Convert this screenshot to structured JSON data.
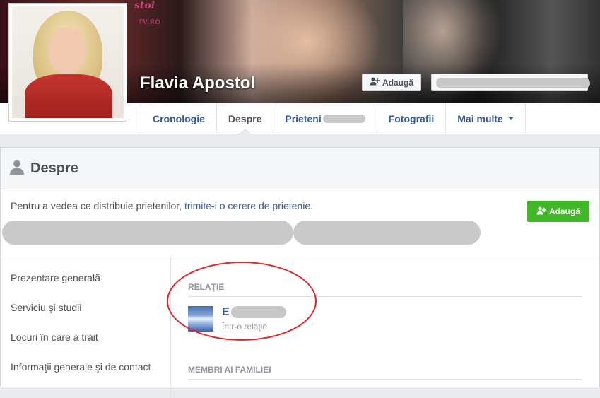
{
  "cover": {
    "watermark_text": "stol",
    "watermark_url": "TV.RO"
  },
  "profile": {
    "name": "Flavia Apostol",
    "add_friend_label": "Adaugă"
  },
  "timeline_nav": {
    "tabs": [
      {
        "label": "Cronologie"
      },
      {
        "label": "Despre"
      },
      {
        "label": "Prieteni"
      },
      {
        "label": "Fotografii"
      },
      {
        "label": "Mai multe"
      }
    ],
    "active_tab": "Despre"
  },
  "about": {
    "title": "Despre",
    "notice_prefix": "Pentru a vedea ce distribuie prietenilor, ",
    "notice_link": "trimite-i o cerere de prietenie",
    "notice_suffix": ".",
    "add_friend_label": "Adaugă",
    "side_nav": [
      {
        "label": "Prezentare generală"
      },
      {
        "label": "Serviciu şi studii"
      },
      {
        "label": "Locuri în care a trăit"
      },
      {
        "label": "Informaţii generale şi de contact"
      }
    ],
    "relationship": {
      "section_label": "RELAŢIE",
      "partner_initial": "E",
      "status": "Într-o relaţie"
    },
    "family": {
      "section_label": "MEMBRI AI FAMILIEI"
    }
  },
  "colors": {
    "link_blue": "#365899",
    "green_button": "#42b72a",
    "annotation_red": "#e2262b"
  }
}
